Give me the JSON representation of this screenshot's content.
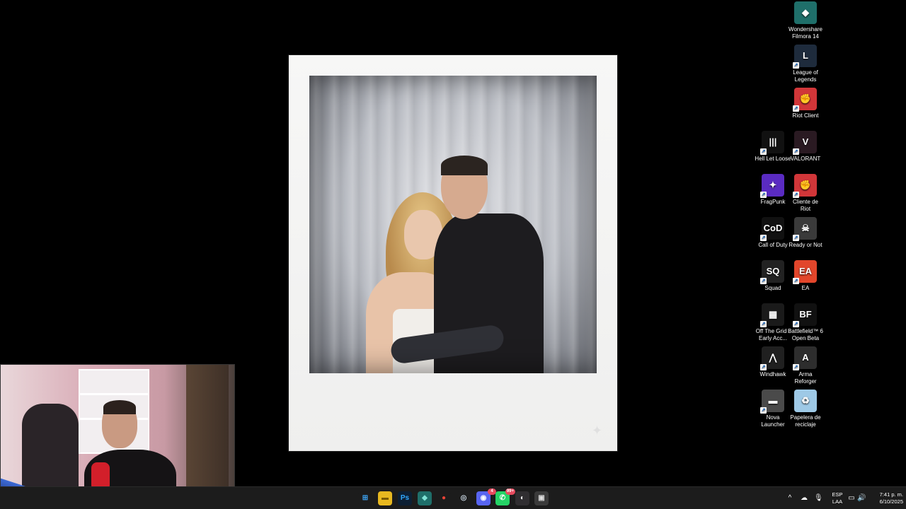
{
  "desktop": {
    "icons": [
      {
        "label": "Wondershare Filmora 14",
        "glyph": "◆",
        "bg": "#1f6f6a",
        "icon": "filmora-icon"
      },
      {
        "label": "League of Legends",
        "glyph": "L",
        "bg": "#1e2b3c",
        "icon": "league-of-legends-icon"
      },
      {
        "label": "Riot Client",
        "glyph": "✊",
        "bg": "#d13639",
        "icon": "riot-client-icon"
      },
      {
        "label": "Hell Let Loose",
        "glyph": "|||",
        "bg": "#111111",
        "icon": "hell-let-loose-icon"
      },
      {
        "label": "VALORANT",
        "glyph": "V",
        "bg": "#2a1a22",
        "icon": "valorant-icon"
      },
      {
        "label": "FragPunk",
        "glyph": "✦",
        "bg": "#5a2bc2",
        "icon": "fragpunk-icon"
      },
      {
        "label": "Cliente de Riot",
        "glyph": "✊",
        "bg": "#d13639",
        "icon": "cliente-de-riot-icon"
      },
      {
        "label": "Call of Duty",
        "glyph": "CoD",
        "bg": "#111111",
        "icon": "call-of-duty-icon"
      },
      {
        "label": "Ready or Not",
        "glyph": "☠",
        "bg": "#3a3a3a",
        "icon": "ready-or-not-icon"
      },
      {
        "label": "Squad",
        "glyph": "SQ",
        "bg": "#222222",
        "icon": "squad-icon"
      },
      {
        "label": "EA",
        "glyph": "EA",
        "bg": "#e2462b",
        "icon": "ea-icon"
      },
      {
        "label": "Off The Grid - Early Acc...",
        "glyph": "▦",
        "bg": "#1a1a1a",
        "icon": "off-the-grid-icon"
      },
      {
        "label": "Battlefield™ 6 Open Beta",
        "glyph": "BF",
        "bg": "#111111",
        "icon": "battlefield-icon"
      },
      {
        "label": "Windhawk",
        "glyph": "⋀",
        "bg": "#202020",
        "icon": "windhawk-icon"
      },
      {
        "label": "Arma Reforger",
        "glyph": "A",
        "bg": "#2d2d2d",
        "icon": "arma-reforger-icon"
      },
      {
        "label": "Nova Launcher",
        "glyph": "▬",
        "bg": "#4a4a4a",
        "icon": "nova-launcher-icon"
      },
      {
        "label": "Papelera de reciclaje",
        "glyph": "♻",
        "bg": "#9ec9e6",
        "icon": "recycle-bin-icon"
      }
    ]
  },
  "taskbar": {
    "apps": [
      {
        "name": "start-button",
        "glyph": "⊞",
        "bg": "#1c1c1c",
        "color": "#3da5f5"
      },
      {
        "name": "file-explorer-icon",
        "glyph": "▬",
        "bg": "#e8b820",
        "color": "#7a5a00"
      },
      {
        "name": "photoshop-icon",
        "glyph": "Ps",
        "bg": "#0d1f33",
        "color": "#31a8ff"
      },
      {
        "name": "filmora-taskbar-icon",
        "glyph": "◆",
        "bg": "#1f6f6a",
        "color": "#7fe3d6"
      },
      {
        "name": "chrome-icon",
        "glyph": "●",
        "bg": "#1c1c1c",
        "color": "#e94235"
      },
      {
        "name": "steam-icon",
        "glyph": "◎",
        "bg": "#1c1c1c",
        "color": "#c7d5e0"
      },
      {
        "name": "discord-icon",
        "glyph": "◉",
        "bg": "#5865f2",
        "color": "#ffffff",
        "badge": "4"
      },
      {
        "name": "whatsapp-icon",
        "glyph": "✆",
        "bg": "#25d366",
        "color": "#ffffff",
        "badge": "99+"
      },
      {
        "name": "obs-icon",
        "glyph": "◐",
        "bg": "#302e31",
        "color": "#ffffff"
      },
      {
        "name": "photo-viewer-icon",
        "glyph": "▣",
        "bg": "#3a3a3a",
        "color": "#dddddd"
      }
    ],
    "tray": {
      "chevron": "^",
      "language_line1": "ESP",
      "language_line2": "LAA",
      "time": "7:41 p. m.",
      "date": "6/10/2025"
    }
  }
}
